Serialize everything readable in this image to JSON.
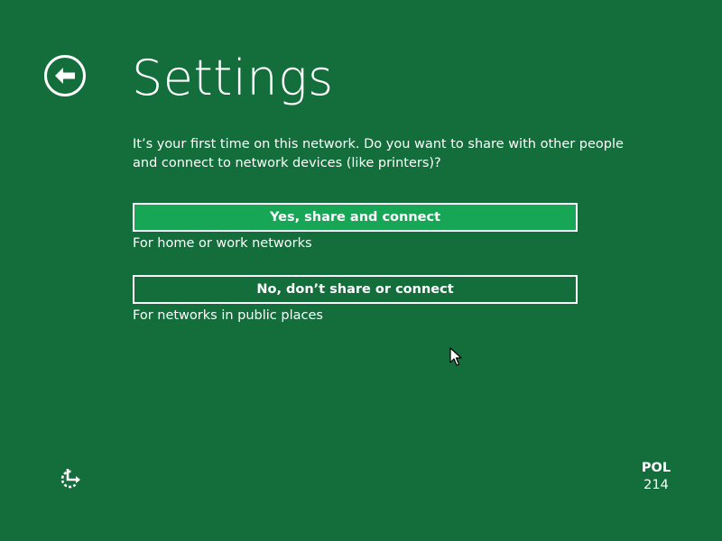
{
  "header": {
    "title": "Settings",
    "back_icon": "back-arrow-circle-icon"
  },
  "prompt": {
    "text": "It’s your first time on this network. Do you want to share with other people and connect to network devices (like printers)?"
  },
  "choices": [
    {
      "label": "Yes, share and connect",
      "description": "For home or work networks",
      "selected": true
    },
    {
      "label": "No, don’t share or connect",
      "description": "For networks in public places",
      "selected": false
    }
  ],
  "footer": {
    "ease_of_access_icon": "ease-of-access-icon",
    "language_code": "POL",
    "language_id": "214"
  },
  "colors": {
    "background": "#136e3b",
    "selected_button": "#16a656",
    "foreground": "#ffffff"
  }
}
